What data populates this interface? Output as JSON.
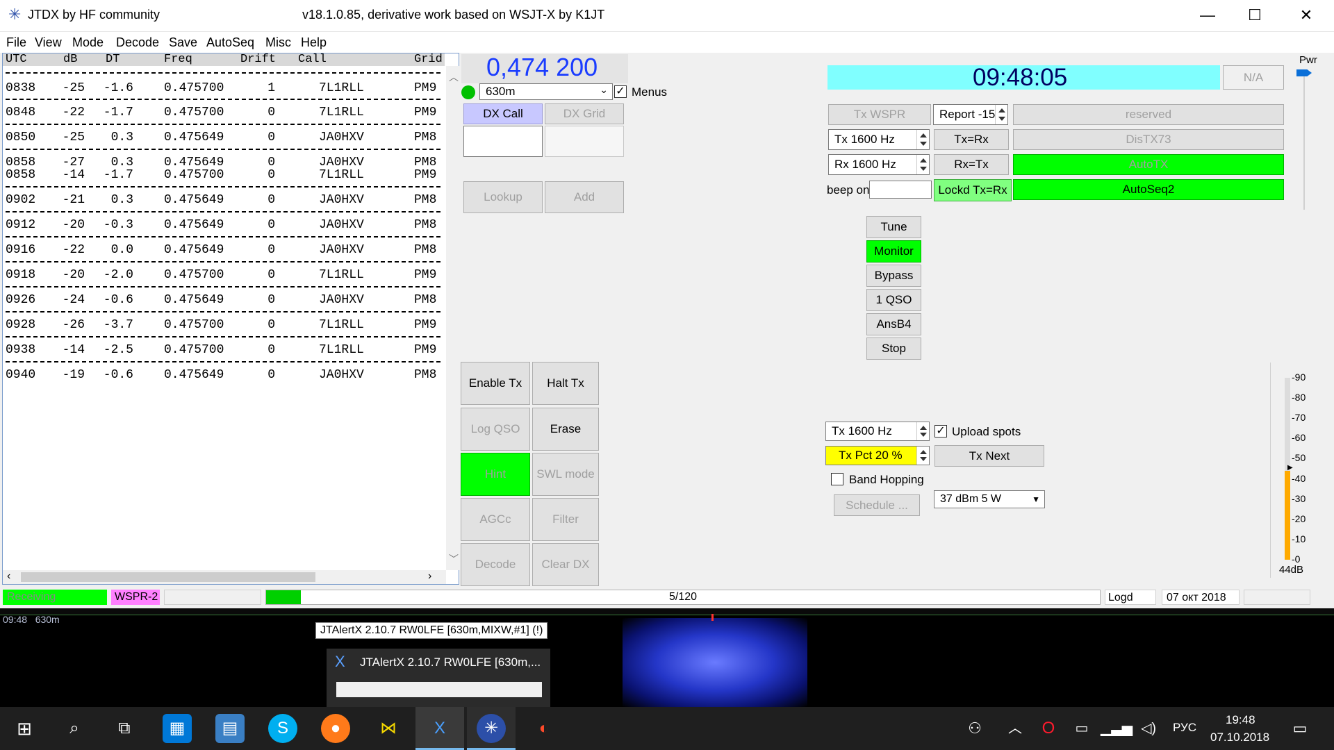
{
  "window": {
    "app_title": "JTDX  by HF community",
    "subtitle": "v18.1.0.85, derivative work based on WSJT-X by K1JT",
    "minimize": "—",
    "maximize": "☐",
    "close": "✕"
  },
  "menu": [
    "File",
    "View",
    "Mode",
    "Decode",
    "Save",
    "AutoSeq",
    "Misc",
    "Help"
  ],
  "decode_table": {
    "headers": [
      "UTC",
      "dB",
      "DT",
      "Freq",
      "Drift",
      "Call",
      "Grid"
    ],
    "rows": [
      [
        "0838",
        "-25",
        "-1.6",
        "0.475700",
        "1",
        "7L1RLL",
        "PM9"
      ],
      [
        "0848",
        "-22",
        "-1.7",
        "0.475700",
        "0",
        "7L1RLL",
        "PM9"
      ],
      [
        "0850",
        "-25",
        "0.3",
        "0.475649",
        "0",
        "JA0HXV",
        "PM8"
      ],
      [
        "0858",
        "-27",
        "0.3",
        "0.475649",
        "0",
        "JA0HXV",
        "PM8"
      ],
      [
        "0858",
        "-14",
        "-1.7",
        "0.475700",
        "0",
        "7L1RLL",
        "PM9"
      ],
      [
        "0902",
        "-21",
        "0.3",
        "0.475649",
        "0",
        "JA0HXV",
        "PM8"
      ],
      [
        "0912",
        "-20",
        "-0.3",
        "0.475649",
        "0",
        "JA0HXV",
        "PM8"
      ],
      [
        "0916",
        "-22",
        "0.0",
        "0.475649",
        "0",
        "JA0HXV",
        "PM8"
      ],
      [
        "0918",
        "-20",
        "-2.0",
        "0.475700",
        "0",
        "7L1RLL",
        "PM9"
      ],
      [
        "0926",
        "-24",
        "-0.6",
        "0.475649",
        "0",
        "JA0HXV",
        "PM8"
      ],
      [
        "0928",
        "-26",
        "-3.7",
        "0.475700",
        "0",
        "7L1RLL",
        "PM9"
      ],
      [
        "0938",
        "-14",
        "-2.5",
        "0.475700",
        "0",
        "7L1RLL",
        "PM9"
      ],
      [
        "0940",
        "-19",
        "-0.6",
        "0.475649",
        "0",
        "JA0HXV",
        "PM8"
      ]
    ]
  },
  "control": {
    "frequency": "0,474 200",
    "band": "630m",
    "menus_label": "Menus",
    "dx_call_label": "DX Call",
    "dx_grid_label": "DX Grid",
    "lookup_label": "Lookup",
    "add_label": "Add",
    "enable_tx": "Enable Tx",
    "halt_tx": "Halt Tx",
    "log_qso": "Log QSO",
    "erase": "Erase",
    "hint": "Hint",
    "swl_mode": "SWL mode",
    "agcc": "AGCc",
    "filter": "Filter",
    "decode": "Decode",
    "clear_dx": "Clear DX"
  },
  "clock": {
    "time": "09:48:05",
    "na": "N/A"
  },
  "tx_panel": {
    "tx_wspr": "Tx WSPR",
    "report": "Report -15",
    "reserved": "reserved",
    "tx_freq": "Tx  1600  Hz",
    "tx_eq_rx": "Tx=Rx",
    "distx73": "DisTX73",
    "rx_freq": "Rx  1600  Hz",
    "rx_eq_tx": "Rx=Tx",
    "autotx": "AutoTX",
    "beep_on": "beep on",
    "lockd": "Lockd Tx=Rx",
    "autoseq2": "AutoSeq2",
    "tune": "Tune",
    "monitor": "Monitor",
    "bypass": "Bypass",
    "one_qso": "1 QSO",
    "ansb4": "AnsB4",
    "stop": "Stop"
  },
  "wspr": {
    "tx_freq": "Tx  1600  Hz",
    "upload_spots": "Upload spots",
    "tx_pct": "Tx Pct 20  %",
    "tx_next": "Tx Next",
    "band_hopping": "Band Hopping",
    "schedule": "Schedule ...",
    "power": "37 dBm  5 W"
  },
  "meter": {
    "pwr_label": "Pwr",
    "ticks": [
      "90",
      "80",
      "70",
      "60",
      "50",
      "40",
      "30",
      "20",
      "10",
      "0"
    ],
    "level_db": "44dB",
    "level_value": 44
  },
  "status": {
    "receiving": "Receiving",
    "mode": "WSPR-2",
    "progress_text": "5/120",
    "progress_fraction": 0.042,
    "logd": "Logd",
    "date": "07 окт 2018"
  },
  "waterfall": {
    "label": "09:48   630m",
    "tooltip": "JTAlertX 2.10.7 RW0LFE [630m,MIXW,#1] (!)",
    "thumb_title": "JTAlertX 2.10.7 RW0LFE [630m,..."
  },
  "taskbar": {
    "lang": "РУС",
    "time": "19:48",
    "date": "07.10.2018"
  }
}
